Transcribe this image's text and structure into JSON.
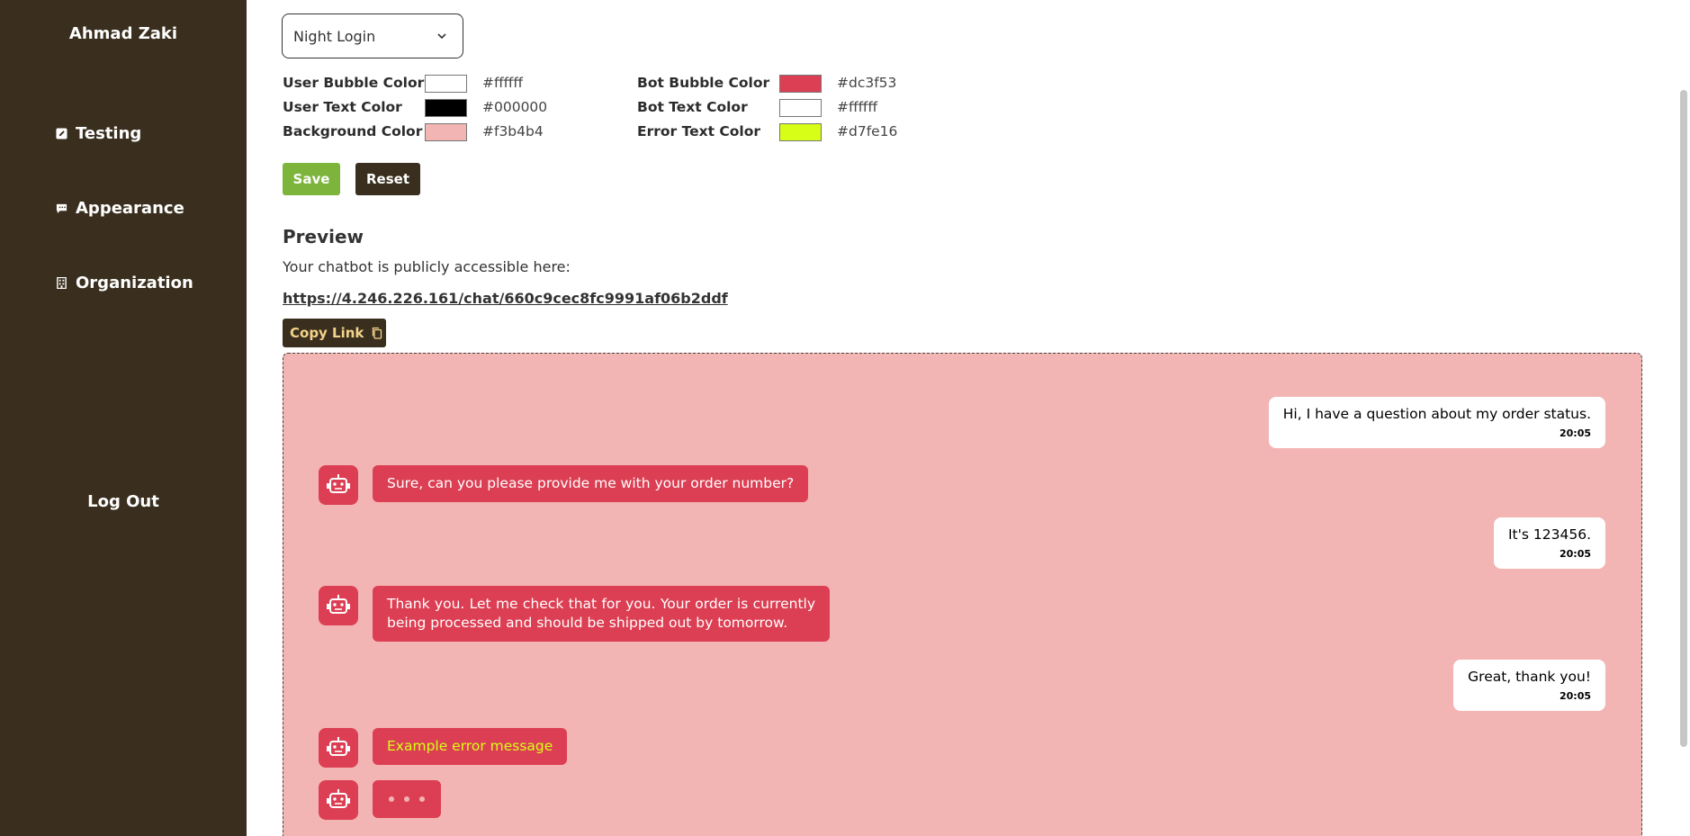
{
  "sidebar": {
    "user_name": "Ahmad Zaki",
    "items": [
      {
        "label": "Testing",
        "icon": "edit-square-icon"
      },
      {
        "label": "Appearance",
        "icon": "chat-bubble-icon"
      },
      {
        "label": "Organization",
        "icon": "building-icon"
      }
    ],
    "logout_label": "Log Out"
  },
  "theme": {
    "selected": "Night Login"
  },
  "colors": {
    "user_bubble": {
      "label": "User Bubble Color",
      "value": "#ffffff"
    },
    "user_text": {
      "label": "User Text Color",
      "value": "#000000"
    },
    "background": {
      "label": "Background Color",
      "value": "#f3b4b4"
    },
    "bot_bubble": {
      "label": "Bot Bubble Color",
      "value": "#dc3f53"
    },
    "bot_text": {
      "label": "Bot Text Color",
      "value": "#ffffff"
    },
    "error_text": {
      "label": "Error Text Color",
      "value": "#d7fe16"
    }
  },
  "buttons": {
    "save": "Save",
    "reset": "Reset"
  },
  "preview": {
    "title": "Preview",
    "description": "Your chatbot is publicly accessible here:",
    "link": "https://4.246.226.161/chat/660c9cec8fc9991af06b2ddf",
    "copy_label": "Copy Link"
  },
  "chat": {
    "messages": [
      {
        "from": "user",
        "text": "Hi, I have a question about my order status.",
        "time": "20:05"
      },
      {
        "from": "bot",
        "text": "Sure, can you please provide me with your order number?"
      },
      {
        "from": "user",
        "text": "It's 123456.",
        "time": "20:05"
      },
      {
        "from": "bot",
        "text": "Thank you. Let me check that for you. Your order is currently being processed and should be shipped out by tomorrow."
      },
      {
        "from": "user",
        "text": "Great, thank you!",
        "time": "20:05"
      },
      {
        "from": "bot",
        "text": "Example error message",
        "error": true
      },
      {
        "from": "bot",
        "typing": true
      }
    ]
  },
  "palette": {
    "sidebar_bg": "#3a2f1e",
    "save_green": "#7db43c",
    "copy_text": "#f3d38a"
  }
}
